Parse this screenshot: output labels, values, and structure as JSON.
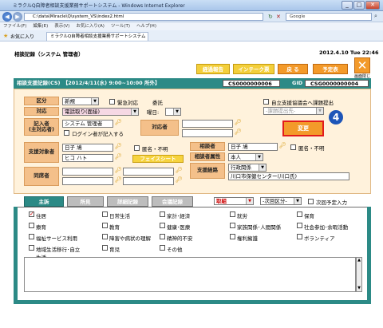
{
  "browser": {
    "title": "ミラクルQ自障者相談支援業務サポートシステム - Windows Internet Explorer",
    "url": "C:\\data\\Miracle\\Q\\system_VS\\index2.html",
    "search_placeholder": "Google",
    "menu": [
      "ファイル(F)",
      "編集(E)",
      "表示(V)",
      "お気に入り(A)",
      "ツール(T)",
      "ヘルプ(H)"
    ],
    "favorites": "お気に入り",
    "tab": "ミラクルQ自障者相談支援業務サポートシステム"
  },
  "header": {
    "title": "相談記録（システム 管理者）",
    "datetime": "2012.4.10 Tue 22:46",
    "btn_report": "経過報告",
    "btn_intake": "インテーク票",
    "btn_back": "戻 る",
    "btn_schedule": "予定表",
    "btn_close": "画面閉じ"
  },
  "bar": {
    "label": "相談支援記録(CS)　【2012/4/11(水) 9:00~10:00 所外】",
    "csid_label": "CSID",
    "csid": "CS0000000006",
    "gid_label": "GID",
    "gid": "CSG0000000004"
  },
  "form": {
    "kubun_label": "区分",
    "kubun_value": "新規",
    "kinkyu_label": "緊急対応",
    "irai_label": "委託",
    "jiritsu_label": "自立支援協議会へ課題提出",
    "kadai_placeholder": "-課題提出先-",
    "taio_label": "対応",
    "taio_value": "電話取り(面接)",
    "nichiji_label": "曜日:",
    "kinyusha_label": "記入者\n(主対応者)",
    "kinyusha_value": "システム 管理者",
    "login_label": "ログイン者が記入する",
    "taiosha_label": "対応者",
    "henko_label": "変更",
    "step": "4",
    "taisho_label": "支援対象者",
    "taisho_name": "日子 鳩",
    "taisho_kana": "ヒコ ハト",
    "tokumei1": "匿名・不明",
    "facesheet": "フェイスシート",
    "sodansha_label": "相談者",
    "sodansha_name": "日子 鳩",
    "tokumei2": "匿名・不明",
    "zokusei_label": "相談者属性",
    "zokusei_value": "本人",
    "keiro_label": "支援経路",
    "keiro_value": "行政関係",
    "keiro_detail": "川口市保健センター(川口氏)",
    "dosekisha_label": "同席者"
  },
  "tabs": {
    "main": "主訴",
    "findings": "所見",
    "detail": "詳細記録",
    "meeting": "会議記録",
    "case": "取組",
    "next_dropdown": "-次回区分-",
    "next_label": "次回予定入力"
  },
  "panel": {
    "items": [
      {
        "label": "住居",
        "checked": true
      },
      {
        "label": "日常生活",
        "checked": false
      },
      {
        "label": "家計･経済",
        "checked": false
      },
      {
        "label": "就労",
        "checked": false
      },
      {
        "label": "保育",
        "checked": false
      },
      {
        "label": "療育",
        "checked": false
      },
      {
        "label": "教育",
        "checked": false
      },
      {
        "label": "健康･医療",
        "checked": false
      },
      {
        "label": "家族関係･人間関係",
        "checked": false
      },
      {
        "label": "社会参加･余暇活動",
        "checked": false
      },
      {
        "label": "福祉サービス利用",
        "checked": false
      },
      {
        "label": "障害や病状の理解",
        "checked": false
      },
      {
        "label": "精神的不安",
        "checked": false
      },
      {
        "label": "権利擁護",
        "checked": false
      },
      {
        "label": "ボランティア",
        "checked": false
      },
      {
        "label": "地域生活移行･自立生活",
        "checked": false
      },
      {
        "label": "育児",
        "checked": false
      },
      {
        "label": "その他",
        "checked": false
      }
    ]
  }
}
